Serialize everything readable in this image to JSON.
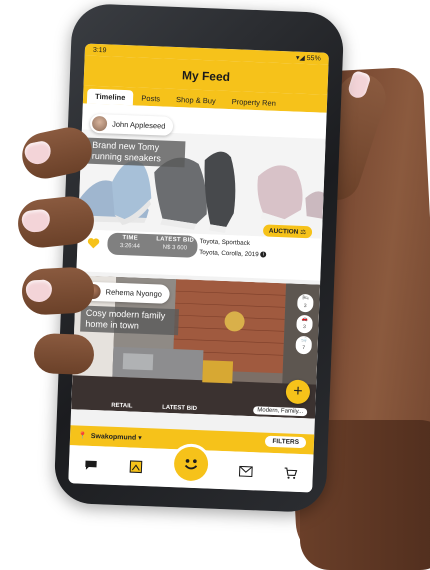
{
  "status": {
    "time": "3:19",
    "battery": "55%"
  },
  "app": {
    "title": "My Feed"
  },
  "tabs": [
    {
      "label": "Timeline",
      "active": true
    },
    {
      "label": "Posts"
    },
    {
      "label": "Shop & Buy"
    },
    {
      "label": "Property Ren"
    }
  ],
  "post1": {
    "user": "John Appleseed",
    "headline": "Brand new Tomy running sneakers",
    "badge": "AUCTION",
    "time_label": "TIME",
    "time_value": "3:26:44",
    "bid_label": "LATEST BID",
    "bid_value": "N$ 3 600",
    "location1": "Toyota, Sportback",
    "location2": "Toyota, Corolla, 2019"
  },
  "post2": {
    "user": "Rehema Nyongo",
    "headline": "Cosy modern family home in town",
    "side_counts": [
      "3",
      "3",
      "7"
    ],
    "retail_label": "RETAIL",
    "latest_bid_label": "LATEST BID",
    "addr": "Modern, Family..."
  },
  "filterbar": {
    "location": "Swakopmund",
    "filters": "FILTERS"
  },
  "colors": {
    "accent": "#f6c21a",
    "dark": "#1b1b1b"
  }
}
